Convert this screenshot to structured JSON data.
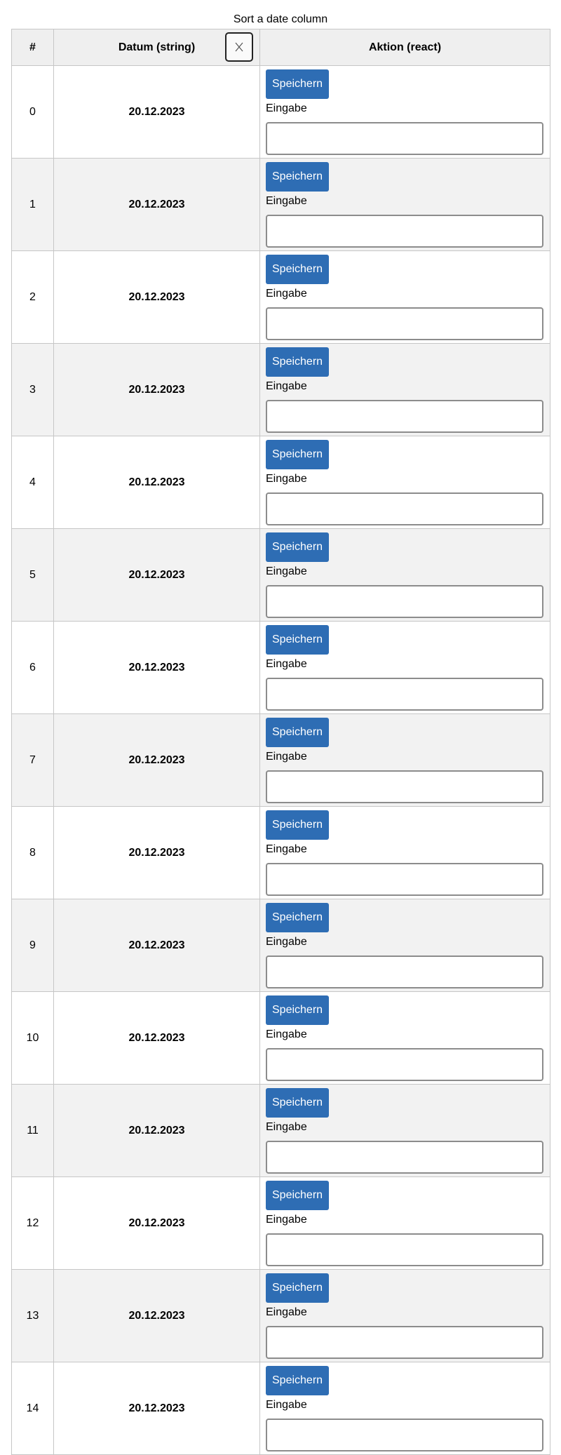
{
  "caption": "Sort a date column",
  "table": {
    "headers": {
      "index": "#",
      "date": "Datum (string)",
      "action": "Aktion (react)"
    },
    "sort_button_icon": "sort-icon",
    "rows": [
      {
        "index": "0",
        "date": "20.12.2023",
        "button": "Speichern",
        "label": "Eingabe",
        "value": ""
      },
      {
        "index": "1",
        "date": "20.12.2023",
        "button": "Speichern",
        "label": "Eingabe",
        "value": ""
      },
      {
        "index": "2",
        "date": "20.12.2023",
        "button": "Speichern",
        "label": "Eingabe",
        "value": ""
      },
      {
        "index": "3",
        "date": "20.12.2023",
        "button": "Speichern",
        "label": "Eingabe",
        "value": ""
      },
      {
        "index": "4",
        "date": "20.12.2023",
        "button": "Speichern",
        "label": "Eingabe",
        "value": ""
      },
      {
        "index": "5",
        "date": "20.12.2023",
        "button": "Speichern",
        "label": "Eingabe",
        "value": ""
      },
      {
        "index": "6",
        "date": "20.12.2023",
        "button": "Speichern",
        "label": "Eingabe",
        "value": ""
      },
      {
        "index": "7",
        "date": "20.12.2023",
        "button": "Speichern",
        "label": "Eingabe",
        "value": ""
      },
      {
        "index": "8",
        "date": "20.12.2023",
        "button": "Speichern",
        "label": "Eingabe",
        "value": ""
      },
      {
        "index": "9",
        "date": "20.12.2023",
        "button": "Speichern",
        "label": "Eingabe",
        "value": ""
      },
      {
        "index": "10",
        "date": "20.12.2023",
        "button": "Speichern",
        "label": "Eingabe",
        "value": ""
      },
      {
        "index": "11",
        "date": "20.12.2023",
        "button": "Speichern",
        "label": "Eingabe",
        "value": ""
      },
      {
        "index": "12",
        "date": "20.12.2023",
        "button": "Speichern",
        "label": "Eingabe",
        "value": ""
      },
      {
        "index": "13",
        "date": "20.12.2023",
        "button": "Speichern",
        "label": "Eingabe",
        "value": ""
      },
      {
        "index": "14",
        "date": "20.12.2023",
        "button": "Speichern",
        "label": "Eingabe",
        "value": ""
      }
    ]
  },
  "colors": {
    "button": "#2e6db4",
    "header_bg": "#efefef",
    "row_alt_bg": "#f2f2f2",
    "border": "#c6c6c6"
  }
}
